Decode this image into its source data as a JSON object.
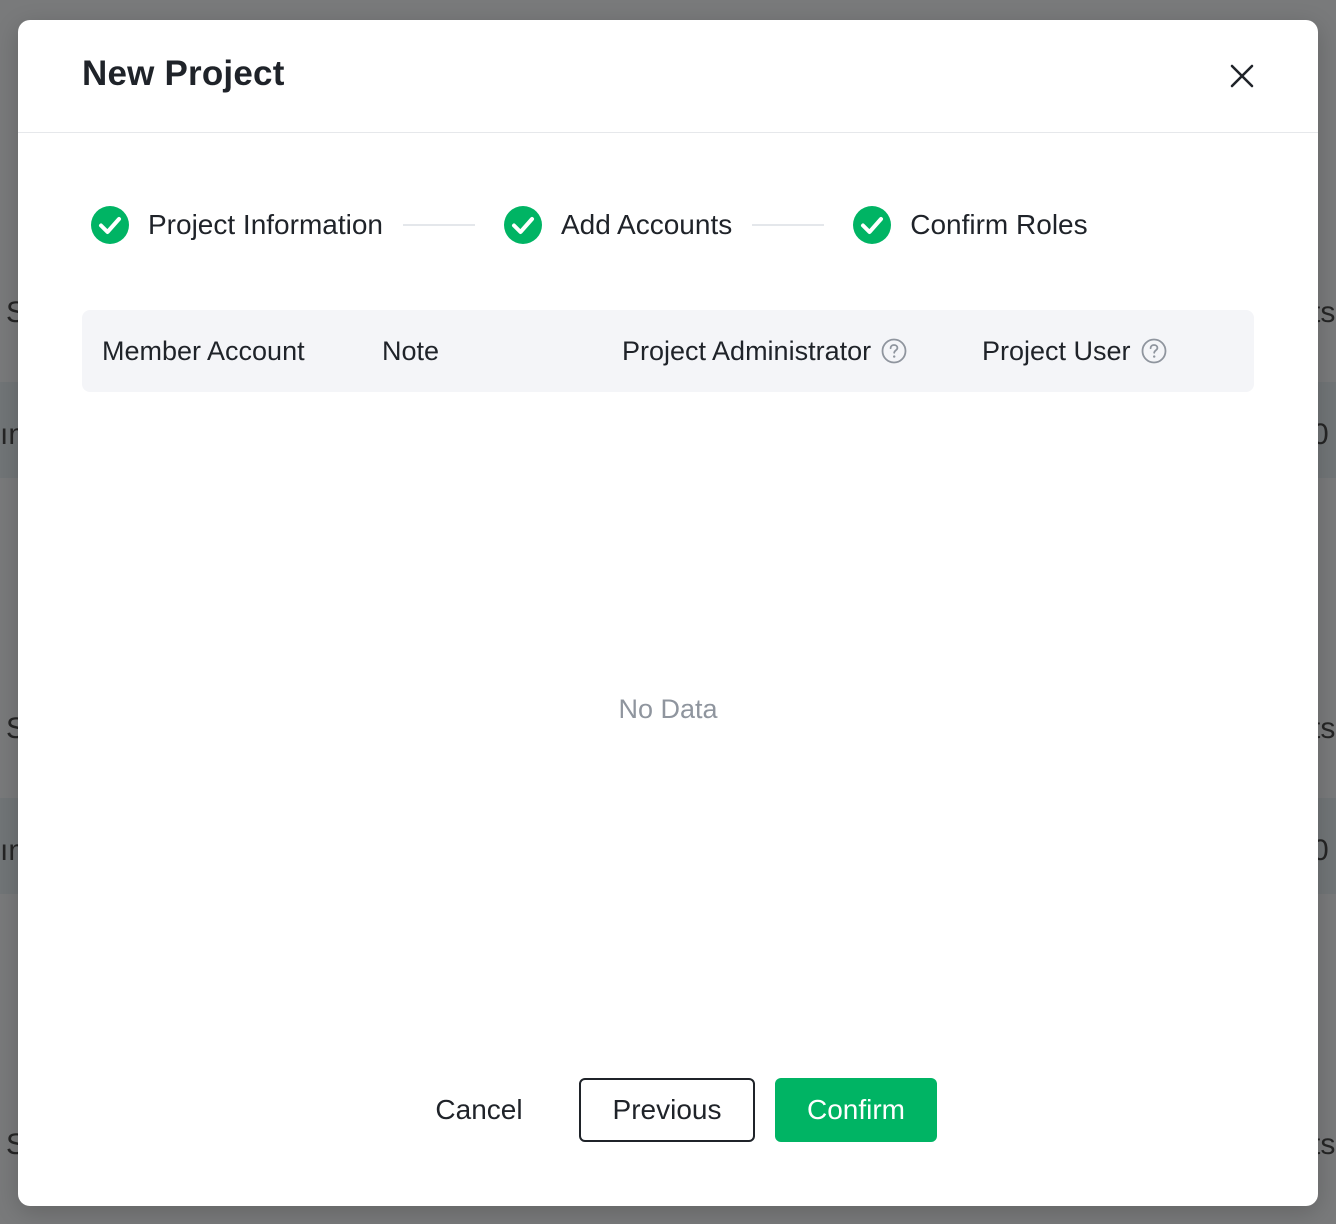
{
  "background": {
    "fragments": [
      "S",
      "ts",
      "ım",
      "0",
      "S",
      "ts",
      "ım",
      "0",
      "S",
      "ts"
    ]
  },
  "dialog": {
    "title": "New Project",
    "close_icon": "close-icon"
  },
  "steps": [
    {
      "label": "Project Information",
      "status": "completed",
      "icon": "check-circle-icon"
    },
    {
      "label": "Add Accounts",
      "status": "completed",
      "icon": "check-circle-icon"
    },
    {
      "label": "Confirm Roles",
      "status": "completed",
      "icon": "check-circle-icon"
    }
  ],
  "table": {
    "columns": [
      {
        "label": "Member Account",
        "help": false
      },
      {
        "label": "Note",
        "help": false
      },
      {
        "label": "Project Administrator",
        "help": true
      },
      {
        "label": "Project User",
        "help": true
      }
    ],
    "rows": [],
    "empty_text": "No Data"
  },
  "footer": {
    "cancel_label": "Cancel",
    "previous_label": "Previous",
    "confirm_label": "Confirm"
  },
  "colors": {
    "accent": "#00b464",
    "text": "#1f2329",
    "muted": "#8f959e",
    "overlay": "rgba(40,40,40,0.6)"
  }
}
